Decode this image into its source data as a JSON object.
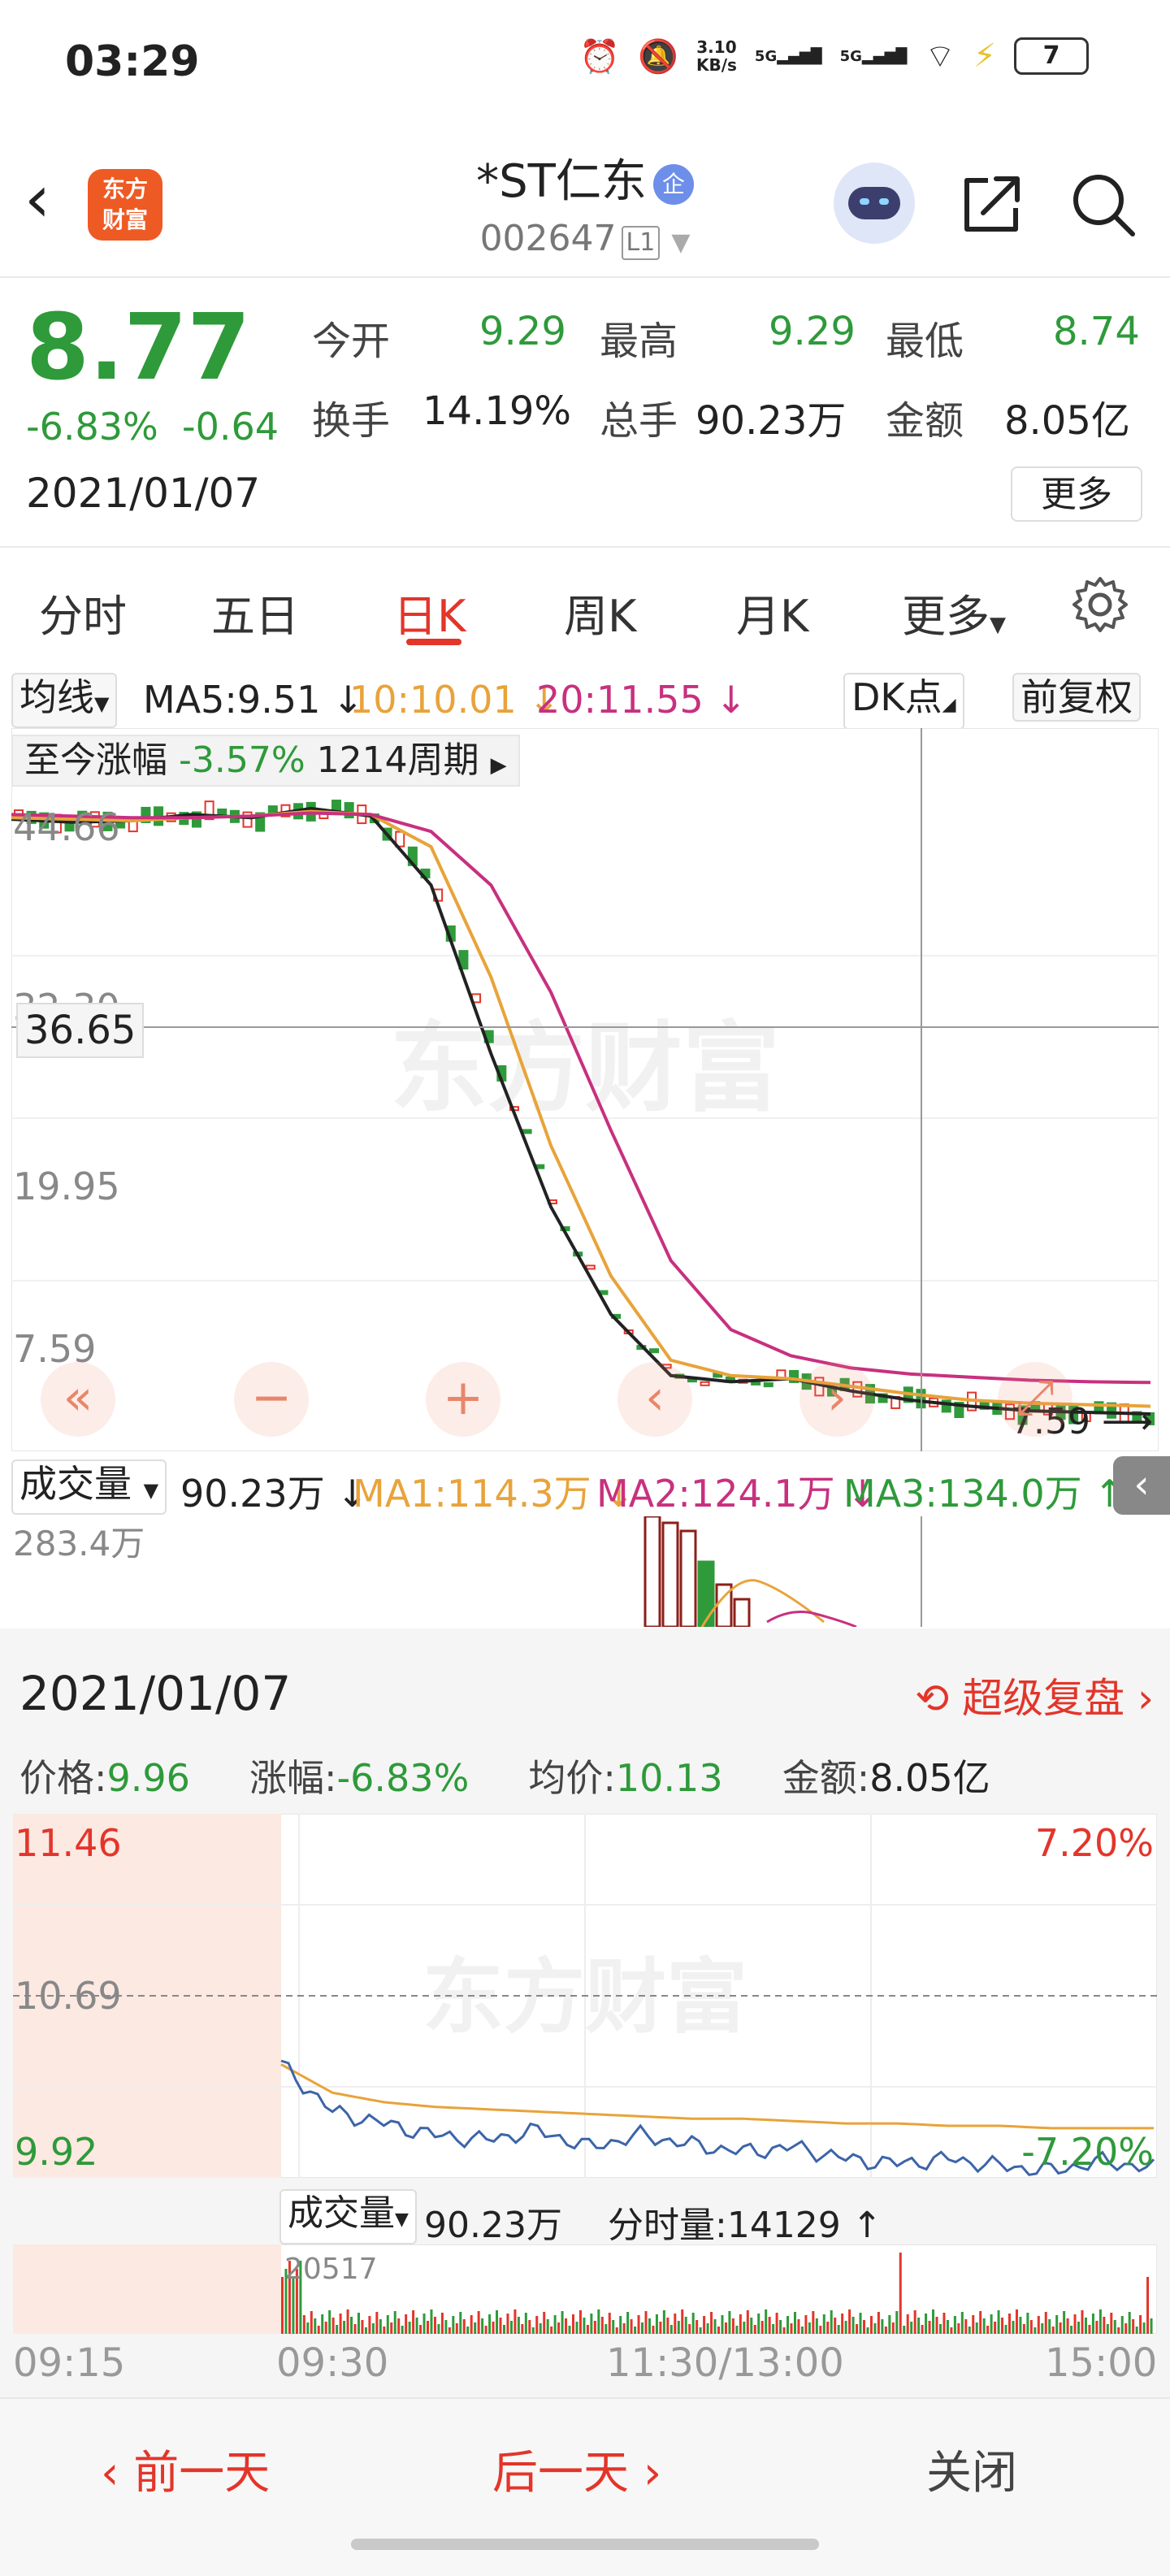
{
  "status_bar": {
    "time": "03:29",
    "net_speed": "3.10",
    "net_unit": "KB/s",
    "sig1": "5G",
    "sig2": "5G",
    "battery": "7"
  },
  "header": {
    "back_label": "‹",
    "logo_line1": "东方",
    "logo_line2": "财富",
    "stock_name": "*ST仁东",
    "name_badge": "企",
    "stock_code": "002647",
    "level_badge": "L1"
  },
  "quote": {
    "price": "8.77",
    "change_pct": "-6.83%",
    "change_amt": "-0.64",
    "date": "2021/01/07",
    "open_label": "今开",
    "open": "9.29",
    "high_label": "最高",
    "high": "9.29",
    "low_label": "最低",
    "low": "8.74",
    "turnover_label": "换手",
    "turnover": "14.19%",
    "volume_label": "总手",
    "volume": "90.23万",
    "amount_label": "金额",
    "amount": "8.05亿",
    "more": "更多"
  },
  "tabs": {
    "t1": "分时",
    "t2": "五日",
    "t3": "日K",
    "t4": "周K",
    "t5": "月K",
    "t6": "更多"
  },
  "ma_row": {
    "indicator": "均线",
    "ma5": "MA5:9.51 ↓",
    "ma10": "10:10.01 ↓",
    "ma20": "20:11.55 ↓",
    "dk": "DK点",
    "adjust": "前复权",
    "ma5_color": "#222222",
    "ma10_color": "#e8a33a",
    "ma20_color": "#c8307f"
  },
  "kchart": {
    "period_label": "至今涨幅",
    "period_pct": "-3.57%",
    "period_len": "1214周期",
    "price_labels": [
      "44.66",
      "32.30",
      "19.95",
      "7.59"
    ],
    "crosshair_value": "36.65",
    "min_marker": "7.59",
    "watermark": "东方财富"
  },
  "chart_data": [
    {
      "type": "line",
      "title": "",
      "xlabel": "",
      "ylabel": "",
      "ylim": [
        7.59,
        50
      ],
      "series": [
        {
          "name": "MA5",
          "values": [
            48.3,
            48.1,
            48.2,
            48.6,
            48.4,
            49.0,
            48.5,
            44.0,
            33.0,
            23.0,
            16.0,
            12.0,
            11.6,
            11.8,
            11.0,
            10.4,
            10.0,
            9.7,
            9.6,
            9.5
          ]
        },
        {
          "name": "10",
          "values": [
            48.4,
            48.3,
            48.2,
            48.4,
            48.5,
            48.8,
            48.6,
            46.5,
            38.0,
            27.0,
            18.5,
            13.0,
            12.0,
            11.8,
            11.3,
            10.8,
            10.4,
            10.2,
            10.1,
            10.0
          ]
        },
        {
          "name": "20",
          "values": [
            48.6,
            48.5,
            48.4,
            48.4,
            48.5,
            48.7,
            48.6,
            47.5,
            44.0,
            37.0,
            28.0,
            19.5,
            15.0,
            13.3,
            12.5,
            12.1,
            11.9,
            11.7,
            11.6,
            11.55
          ]
        }
      ]
    },
    {
      "type": "line",
      "title": "",
      "xlabel": "",
      "ylabel": "",
      "categories": [
        "09:15",
        "09:30",
        "11:30/13:00",
        "15:00"
      ],
      "ylim": [
        9.92,
        11.46
      ],
      "series": [
        {
          "name": "价格",
          "values": [
            10.4,
            10.2,
            10.15,
            10.1,
            10.08,
            10.12,
            10.05,
            10.1,
            10.06,
            10.03,
            10.05,
            10.0,
            9.98,
            10.0,
            9.97,
            9.95,
            9.99,
            9.96
          ]
        },
        {
          "name": "均价",
          "values": [
            10.4,
            10.28,
            10.24,
            10.22,
            10.21,
            10.2,
            10.19,
            10.18,
            10.17,
            10.17,
            10.16,
            10.15,
            10.15,
            10.14,
            10.14,
            10.13,
            10.13,
            10.13
          ]
        }
      ]
    }
  ],
  "volume_row": {
    "label": "成交量",
    "value": "90.23万 ↓",
    "ma1": "MA1:114.3万 ↓",
    "ma2": "MA2:124.1万 ↓",
    "ma3": "MA3:134.0万 ↑",
    "top": "283.4万",
    "ma1_color": "#e8a33a",
    "ma2_color": "#c8307f",
    "ma3_color": "#2e9a3a"
  },
  "sheet": {
    "date": "2021/01/07",
    "replay": "超级复盘",
    "price_label": "价格:",
    "price": "9.96",
    "pct_label": "涨幅:",
    "pct": "-6.83%",
    "avg_label": "均价:",
    "avg": "10.13",
    "amount_label": "金额:",
    "amount": "8.05亿",
    "y_top": "11.46",
    "y_mid": "10.69",
    "y_bot": "9.92",
    "pct_top": "7.20%",
    "pct_bot": "-7.20%",
    "vol_label": "成交量",
    "vol_value": "90.23万",
    "tick_label": "分时量:",
    "tick_value": "14129 ↑",
    "vol_top": "20517",
    "t1": "09:15",
    "t2": "09:30",
    "t3": "11:30/13:00",
    "t4": "15:00",
    "watermark": "东方财富"
  },
  "nav": {
    "prev": "前一天",
    "next": "后一天",
    "close": "关闭"
  }
}
